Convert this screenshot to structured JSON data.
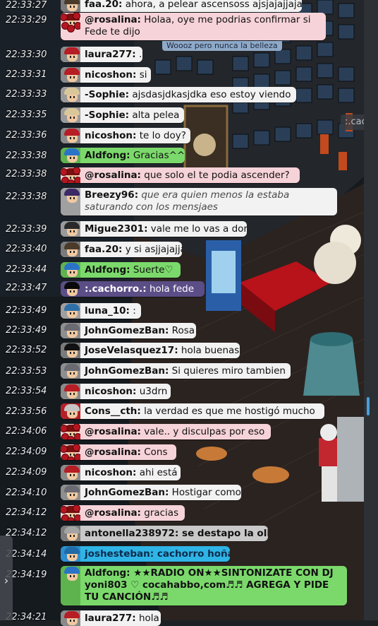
{
  "colors": {
    "white_bubble": "#f2f2f2",
    "pink_bubble": "#f6d3d8",
    "green_bubble": "#7bd96b",
    "purple_bubble": "#5b4d86",
    "blue_bubble": "#2fb4e6",
    "grey_bubble": "#c9c9c9",
    "scroll_thumb": "#4a9ed8"
  },
  "chat": [
    {
      "time": "22:33:27",
      "user": "faa.20:",
      "text": "ahora, a pelear ascensoss ajsjajajjajaj",
      "style": "white",
      "avatar": "faa"
    },
    {
      "time": "22:33:29",
      "user": "@rosalina:",
      "text": "Holaa, oye me podrias confirmar si Fede te dijo",
      "style": "pink",
      "avatar": "rosalina",
      "multi": true
    },
    {
      "time": "22:33:30",
      "user": "laura277:",
      "text": ".",
      "style": "white",
      "avatar": "cap-red"
    },
    {
      "time": "22:33:31",
      "user": "nicoshon:",
      "text": "si",
      "style": "white",
      "avatar": "cap-red"
    },
    {
      "time": "22:33:33",
      "user": "-Sophie:",
      "text": "ajsdasjdkasjdka eso estoy viendo",
      "style": "white",
      "avatar": "sophie"
    },
    {
      "time": "22:33:35",
      "user": "-Sophie:",
      "text": "alta pelea",
      "style": "white",
      "avatar": "sophie"
    },
    {
      "time": "22:33:36",
      "user": "nicoshon:",
      "text": "te lo doy?",
      "style": "white",
      "avatar": "cap-red"
    },
    {
      "time": "22:33:38",
      "user": "Aldfong:",
      "text": "Gracias^^",
      "style": "green",
      "avatar": "aldfong"
    },
    {
      "time": "22:33:38",
      "user": "@rosalina:",
      "text": "que solo el te podia ascender?",
      "style": "pink",
      "avatar": "rosalina"
    },
    {
      "time": "22:33:38",
      "user": "Breezy96:",
      "text": "que era quien menos la estaba saturando con los mensjaes",
      "style": "italic",
      "avatar": "breezy",
      "multi": true
    },
    {
      "time": "22:33:39",
      "user": "Migue2301:",
      "text": "vale me lo vas a dor",
      "style": "white",
      "avatar": "migue"
    },
    {
      "time": "22:33:40",
      "user": "faa.20:",
      "text": "y si asjjajajja",
      "style": "white",
      "avatar": "faa"
    },
    {
      "time": "22:33:44",
      "user": "Aldfong:",
      "text": "Suerte♡",
      "style": "green",
      "avatar": "aldfong"
    },
    {
      "time": "22:33:47",
      "user": ":.cachorro.:",
      "text": "hola fede",
      "style": "purple",
      "avatar": "cachorro"
    },
    {
      "time": "22:33:49",
      "user": "luna_10:",
      "text": ":",
      "style": "white",
      "avatar": "luna"
    },
    {
      "time": "22:33:49",
      "user": "JohnGomezBan:",
      "text": "Rosa",
      "style": "white",
      "avatar": "john"
    },
    {
      "time": "22:33:52",
      "user": "JoseVelasquez17:",
      "text": "hola buenas",
      "style": "white",
      "avatar": "jose"
    },
    {
      "time": "22:33:53",
      "user": "JohnGomezBan:",
      "text": "Si quieres miro tambien",
      "style": "white",
      "avatar": "john"
    },
    {
      "time": "22:33:54",
      "user": "nicoshon:",
      "text": "u3drn",
      "style": "white",
      "avatar": "cap-red"
    },
    {
      "time": "22:33:56",
      "user": "Cons__cth:",
      "text": "la verdad es que me hostigó mucho",
      "style": "white",
      "avatar": "cons"
    },
    {
      "time": "22:34:06",
      "user": "@rosalina:",
      "text": "vale.. y disculpas por eso",
      "style": "pink",
      "avatar": "rosalina"
    },
    {
      "time": "22:34:09",
      "user": "@rosalina:",
      "text": "Cons",
      "style": "pink",
      "avatar": "rosalina"
    },
    {
      "time": "22:34:09",
      "user": "nicoshon:",
      "text": "ahi está",
      "style": "white",
      "avatar": "cap-red"
    },
    {
      "time": "22:34:10",
      "user": "JohnGomezBan:",
      "text": "Hostigar como?",
      "style": "white",
      "avatar": "john"
    },
    {
      "time": "22:34:12",
      "user": "@rosalina:",
      "text": "gracias",
      "style": "pink",
      "avatar": "rosalina"
    },
    {
      "time": "22:34:12",
      "user": "antonella238972:",
      "text": "se destapo la olla",
      "style": "grey-bold",
      "avatar": "antonella"
    },
    {
      "time": "22:34:14",
      "user": "joshesteban:",
      "text": "cachorro hoña",
      "style": "blue-bold",
      "avatar": "josh"
    },
    {
      "time": "22:34:19",
      "user": "Aldfong:",
      "text": "★★RADIO ON★★SINTONIZATE CON DJ yoni803 ♡ cocahabbo,com♬♬ AGREGA Y PIDE TU CANCIÓN♬♬",
      "style": "green-bold",
      "avatar": "aldfong",
      "multi": true
    },
    {
      "time": "22:34:21",
      "user": "laura277:",
      "text": "hola",
      "style": "white",
      "avatar": "cap-red"
    }
  ],
  "room_texts": {
    "cachorro_tag": ":.cac",
    "faded_bubble": "Woooz   pero nunca la belleza"
  },
  "controls": {
    "expand_arrow": "›"
  }
}
